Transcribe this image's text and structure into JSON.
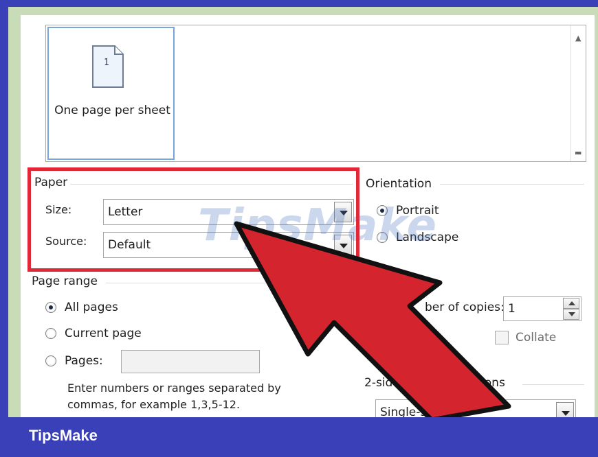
{
  "layout": {
    "item_label": "One page per sheet",
    "page_number": "1"
  },
  "paper": {
    "title": "Paper",
    "size_label": "Size:",
    "size_value": "Letter",
    "source_label": "Source:",
    "source_value": "Default"
  },
  "orientation": {
    "title": "Orientation",
    "portrait": "Portrait",
    "landscape": "Landscape",
    "selected": "Portrait"
  },
  "page_range": {
    "title": "Page range",
    "all_pages": "All pages",
    "current_page": "Current page",
    "pages": "Pages:",
    "pages_value": "",
    "hint": "Enter numbers or ranges separated by commas, for example 1,3,5-12.",
    "selected": "All pages"
  },
  "copies": {
    "label_visible": "ber of copies:",
    "value": "1",
    "collate": "Collate"
  },
  "two_sided": {
    "title_visible_start": "2-sid",
    "title_visible_end": "g options",
    "value_visible": "Single-sided"
  },
  "watermark": "TipsMake",
  "footer": {
    "brand": "TipsMake"
  },
  "colors": {
    "highlight": "#e02838",
    "arrow": "#d4252f",
    "footer": "#3a40b8"
  }
}
